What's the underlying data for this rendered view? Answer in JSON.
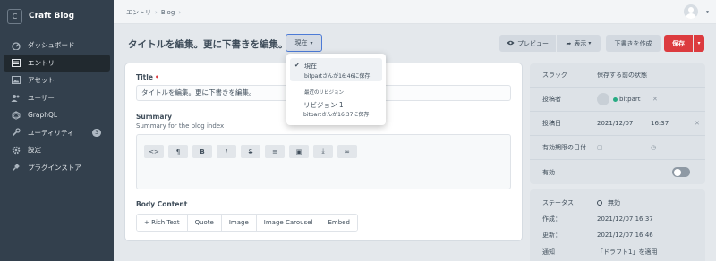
{
  "app": {
    "logo_letter": "C",
    "name": "Craft Blog"
  },
  "sidebar": {
    "items": [
      {
        "label": "ダッシュボード",
        "icon": "dashboard-icon"
      },
      {
        "label": "エントリ",
        "icon": "entries-icon",
        "active": true
      },
      {
        "label": "アセット",
        "icon": "assets-icon"
      },
      {
        "label": "ユーザー",
        "icon": "users-icon"
      },
      {
        "label": "GraphQL",
        "icon": "graphql-icon"
      },
      {
        "label": "ユーティリティ",
        "icon": "utilities-icon",
        "badge": "3"
      },
      {
        "label": "設定",
        "icon": "settings-icon"
      },
      {
        "label": "プラグインストア",
        "icon": "plugin-store-icon"
      }
    ]
  },
  "breadcrumbs": [
    "エントリ",
    "Blog"
  ],
  "header": {
    "title": "タイトルを編集。更に下書きを編集。",
    "revision_button": "現在",
    "preview_button": "プレビュー",
    "share_button": "表示",
    "draft_button": "下書きを作成",
    "save_button": "保存"
  },
  "revision_menu": {
    "current_title": "現在",
    "current_meta": "bitpartさんが16:46に保存",
    "section_label": "最近のリビジョン",
    "revision_title": "リビジョン 1",
    "revision_meta": "bitpartさんが16:37に保存"
  },
  "editor": {
    "title_label": "Title",
    "title_value": "タイトルを編集。更に下書きを編集。",
    "summary_label": "Summary",
    "summary_hint": "Summary for the blog index",
    "toolbar": [
      "<>",
      "¶",
      "B",
      "I",
      "S",
      "≡",
      "▣",
      "⤓",
      "∞"
    ],
    "body_label": "Body Content",
    "blocks": [
      "+ Rich Text",
      "Quote",
      "Image",
      "Image Carousel",
      "Embed"
    ]
  },
  "meta": {
    "slug_label": "スラッグ",
    "slug_value": "保存する前の状態",
    "author_label": "投稿者",
    "author_name": "bitpart",
    "postdate_label": "投稿日",
    "postdate_date": "2021/12/07",
    "postdate_time": "16:37",
    "expiry_label": "有効期限の日付",
    "enabled_label": "有効",
    "enabled": false
  },
  "status": {
    "status_label": "ステータス",
    "status_value": "無効",
    "created_label": "作成：",
    "created_value": "2021/12/07 16:37",
    "updated_label": "更新：",
    "updated_value": "2021/12/07 16:46",
    "notes_label": "通知",
    "notes_value": "「ドラフト1」を適用"
  }
}
